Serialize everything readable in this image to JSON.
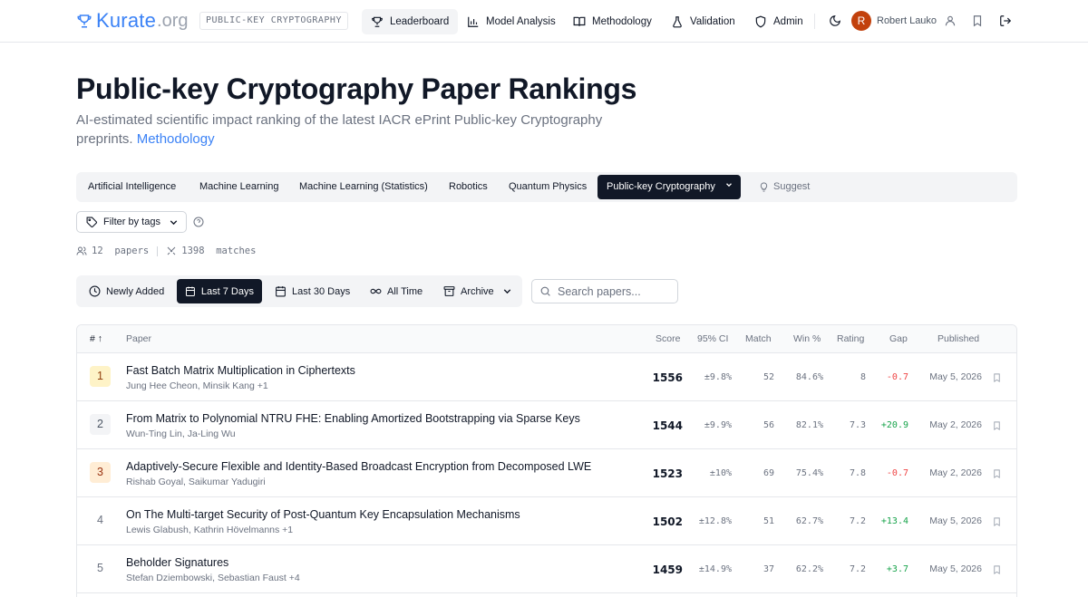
{
  "nav": {
    "logo_main": "Kurate",
    "logo_suffix": ".org",
    "category_badge": "PUBLIC-KEY CRYPTOGRAPHY",
    "links": [
      {
        "label": "Leaderboard",
        "icon": "trophy-icon",
        "active": true
      },
      {
        "label": "Model Analysis",
        "icon": "bar-chart-icon",
        "active": false
      },
      {
        "label": "Methodology",
        "icon": "book-icon",
        "active": false
      },
      {
        "label": "Validation",
        "icon": "flask-icon",
        "active": false
      },
      {
        "label": "Admin",
        "icon": "shield-icon",
        "active": false
      }
    ],
    "user_initial": "R",
    "user_name": "Robert Lauko"
  },
  "header": {
    "title": "Public-key Cryptography Paper Rankings",
    "subtitle": "AI-estimated scientific impact ranking of the latest IACR ePrint Public-key Cryptography preprints.",
    "subtitle_link": "Methodology"
  },
  "categories": [
    {
      "label": "Artificial Intelligence",
      "active": false
    },
    {
      "label": "Machine Learning",
      "active": false
    },
    {
      "label": "Machine Learning (Statistics)",
      "active": false
    },
    {
      "label": "Robotics",
      "active": false
    },
    {
      "label": "Quantum Physics",
      "active": false
    },
    {
      "label": "Public-key Cryptography",
      "active": true
    }
  ],
  "suggest_label": "Suggest",
  "filter": {
    "label": "Filter by tags"
  },
  "stats": {
    "papers_count": "12",
    "papers_label": "papers",
    "matches_count": "1398",
    "matches_label": "matches"
  },
  "time_ranges": [
    {
      "label": "Newly Added",
      "icon": "clock-icon",
      "active": false
    },
    {
      "label": "Last 7 Days",
      "icon": "calendar-icon",
      "active": true
    },
    {
      "label": "Last 30 Days",
      "icon": "calendar-icon",
      "active": false
    },
    {
      "label": "All Time",
      "icon": "infinity-icon",
      "active": false
    },
    {
      "label": "Archive",
      "icon": "archive-icon",
      "active": false
    }
  ],
  "search": {
    "placeholder": "Search papers..."
  },
  "table": {
    "columns": {
      "rank": "#",
      "paper": "Paper",
      "score": "Score",
      "ci": "95% CI",
      "match": "Match",
      "win": "Win %",
      "rating": "Rating",
      "gap": "Gap",
      "published": "Published"
    },
    "rows": [
      {
        "rank": "1",
        "title": "Fast Batch Matrix Multiplication in Ciphertexts",
        "authors": "Jung Hee Cheon, Minsik Kang +1",
        "score": "1556",
        "ci": "±9.8%",
        "match": "52",
        "win": "84.6%",
        "rating": "8",
        "gap": "-0.7",
        "gap_sign": "neg",
        "published": "May 5, 2026"
      },
      {
        "rank": "2",
        "title": "From Matrix to Polynomial NTRU FHE: Enabling Amortized Bootstrapping via Sparse Keys",
        "authors": "Wun-Ting Lin, Ja-Ling Wu",
        "score": "1544",
        "ci": "±9.9%",
        "match": "56",
        "win": "82.1%",
        "rating": "7.3",
        "gap": "+20.9",
        "gap_sign": "pos",
        "published": "May 2, 2026"
      },
      {
        "rank": "3",
        "title": "Adaptively-Secure Flexible and Identity-Based Broadcast Encryption from Decomposed LWE",
        "authors": "Rishab Goyal, Saikumar Yadugiri",
        "score": "1523",
        "ci": "±10%",
        "match": "69",
        "win": "75.4%",
        "rating": "7.8",
        "gap": "-0.7",
        "gap_sign": "neg",
        "published": "May 2, 2026"
      },
      {
        "rank": "4",
        "title": "On The Multi-target Security of Post-Quantum Key Encapsulation Mechanisms",
        "authors": "Lewis Glabush, Kathrin Hövelmanns +1",
        "score": "1502",
        "ci": "±12.8%",
        "match": "51",
        "win": "62.7%",
        "rating": "7.2",
        "gap": "+13.4",
        "gap_sign": "pos",
        "published": "May 5, 2026"
      },
      {
        "rank": "5",
        "title": "Beholder Signatures",
        "authors": "Stefan Dziembowski, Sebastian Faust +4",
        "score": "1459",
        "ci": "±14.9%",
        "match": "37",
        "win": "62.2%",
        "rating": "7.2",
        "gap": "+3.7",
        "gap_sign": "pos",
        "published": "May 5, 2026"
      }
    ]
  },
  "colors": {
    "accent": "#3b82f6",
    "dark": "#111827",
    "negative": "#ef4444",
    "positive": "#16a34a",
    "avatar": "#c2410c"
  }
}
